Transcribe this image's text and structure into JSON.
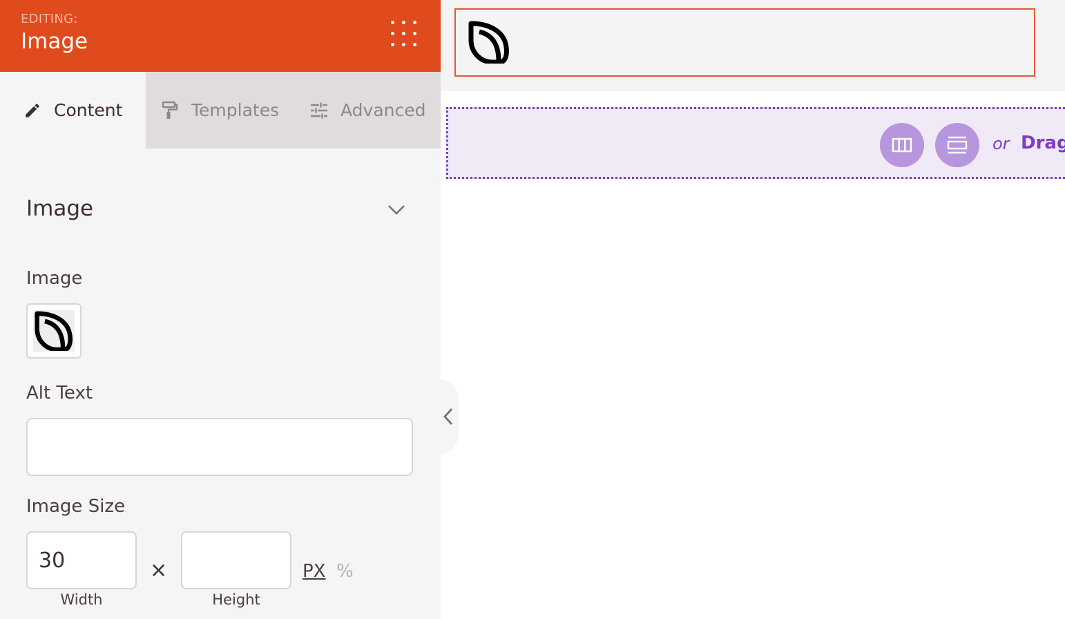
{
  "header": {
    "editing_label": "EDITING:",
    "title": "Image",
    "menu_icon": "dots-grid-icon",
    "background_color": "#e04b1e"
  },
  "tabs": [
    {
      "label": "Content",
      "icon": "pencil-icon",
      "active": true
    },
    {
      "label": "Templates",
      "icon": "paint-roller-icon",
      "active": false
    },
    {
      "label": "Advanced",
      "icon": "sliders-icon",
      "active": false
    }
  ],
  "section": {
    "title": "Image",
    "toggle_icon": "chevron-down-icon"
  },
  "fields": {
    "image_label": "Image",
    "alt_text_label": "Alt Text",
    "alt_text_value": "",
    "image_size_label": "Image Size",
    "width_value": "30",
    "height_value": "",
    "width_caption": "Width",
    "height_caption": "Height",
    "times_symbol": "×",
    "unit_px": "PX",
    "unit_percent": "%",
    "selected_unit": "PX"
  },
  "canvas": {
    "module_selection_color": "#e8553a",
    "drop_zone_color": "#7d3cc9",
    "drop_or": "or",
    "drop_drag": "Drag",
    "buttons": [
      {
        "icon": "columns-icon"
      },
      {
        "icon": "rows-icon"
      }
    ]
  }
}
